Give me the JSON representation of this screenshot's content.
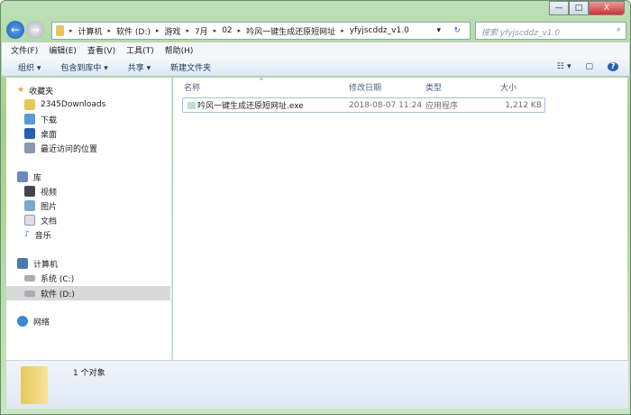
{
  "window": {
    "minimize": "—",
    "maximize": "□",
    "close": "X"
  },
  "nav": {
    "back": "←",
    "forward": "→"
  },
  "address": {
    "crumbs": [
      "计算机",
      "软件 (D:)",
      "游戏",
      "7月",
      "02",
      "吟风一键生成还原短网址",
      "yfyjscddz_v1.0"
    ],
    "separator": "▸",
    "dropdown": "▾",
    "refresh": "↻"
  },
  "search": {
    "placeholder": "搜索 yfyjscddz_v1.0",
    "icon": "⌕"
  },
  "menu": [
    "文件(F)",
    "编辑(E)",
    "查看(V)",
    "工具(T)",
    "帮助(H)"
  ],
  "toolbar": {
    "items": [
      "组织 ▾",
      "包含到库中 ▾",
      "共享 ▾",
      "新建文件夹"
    ],
    "view": "☷ ▾",
    "pane": "▢",
    "help": "?"
  },
  "sidebar": {
    "favorites": "收藏夹",
    "fav_items": [
      "2345Downloads",
      "下载",
      "桌面",
      "最近访问的位置"
    ],
    "libraries": "库",
    "lib_items": [
      "视频",
      "图片",
      "文档",
      "音乐"
    ],
    "computer": "计算机",
    "drives": [
      "系统 (C:)",
      "软件 (D:)"
    ],
    "network": "网络"
  },
  "columns": {
    "name": "名称",
    "date": "修改日期",
    "type": "类型",
    "size": "大小"
  },
  "files": [
    {
      "name": "吟风一键生成还原短网址.exe",
      "date": "2018-08-07 11:24",
      "type": "应用程序",
      "size": "1,212 KB"
    }
  ],
  "status": {
    "count": "1 个对象"
  }
}
